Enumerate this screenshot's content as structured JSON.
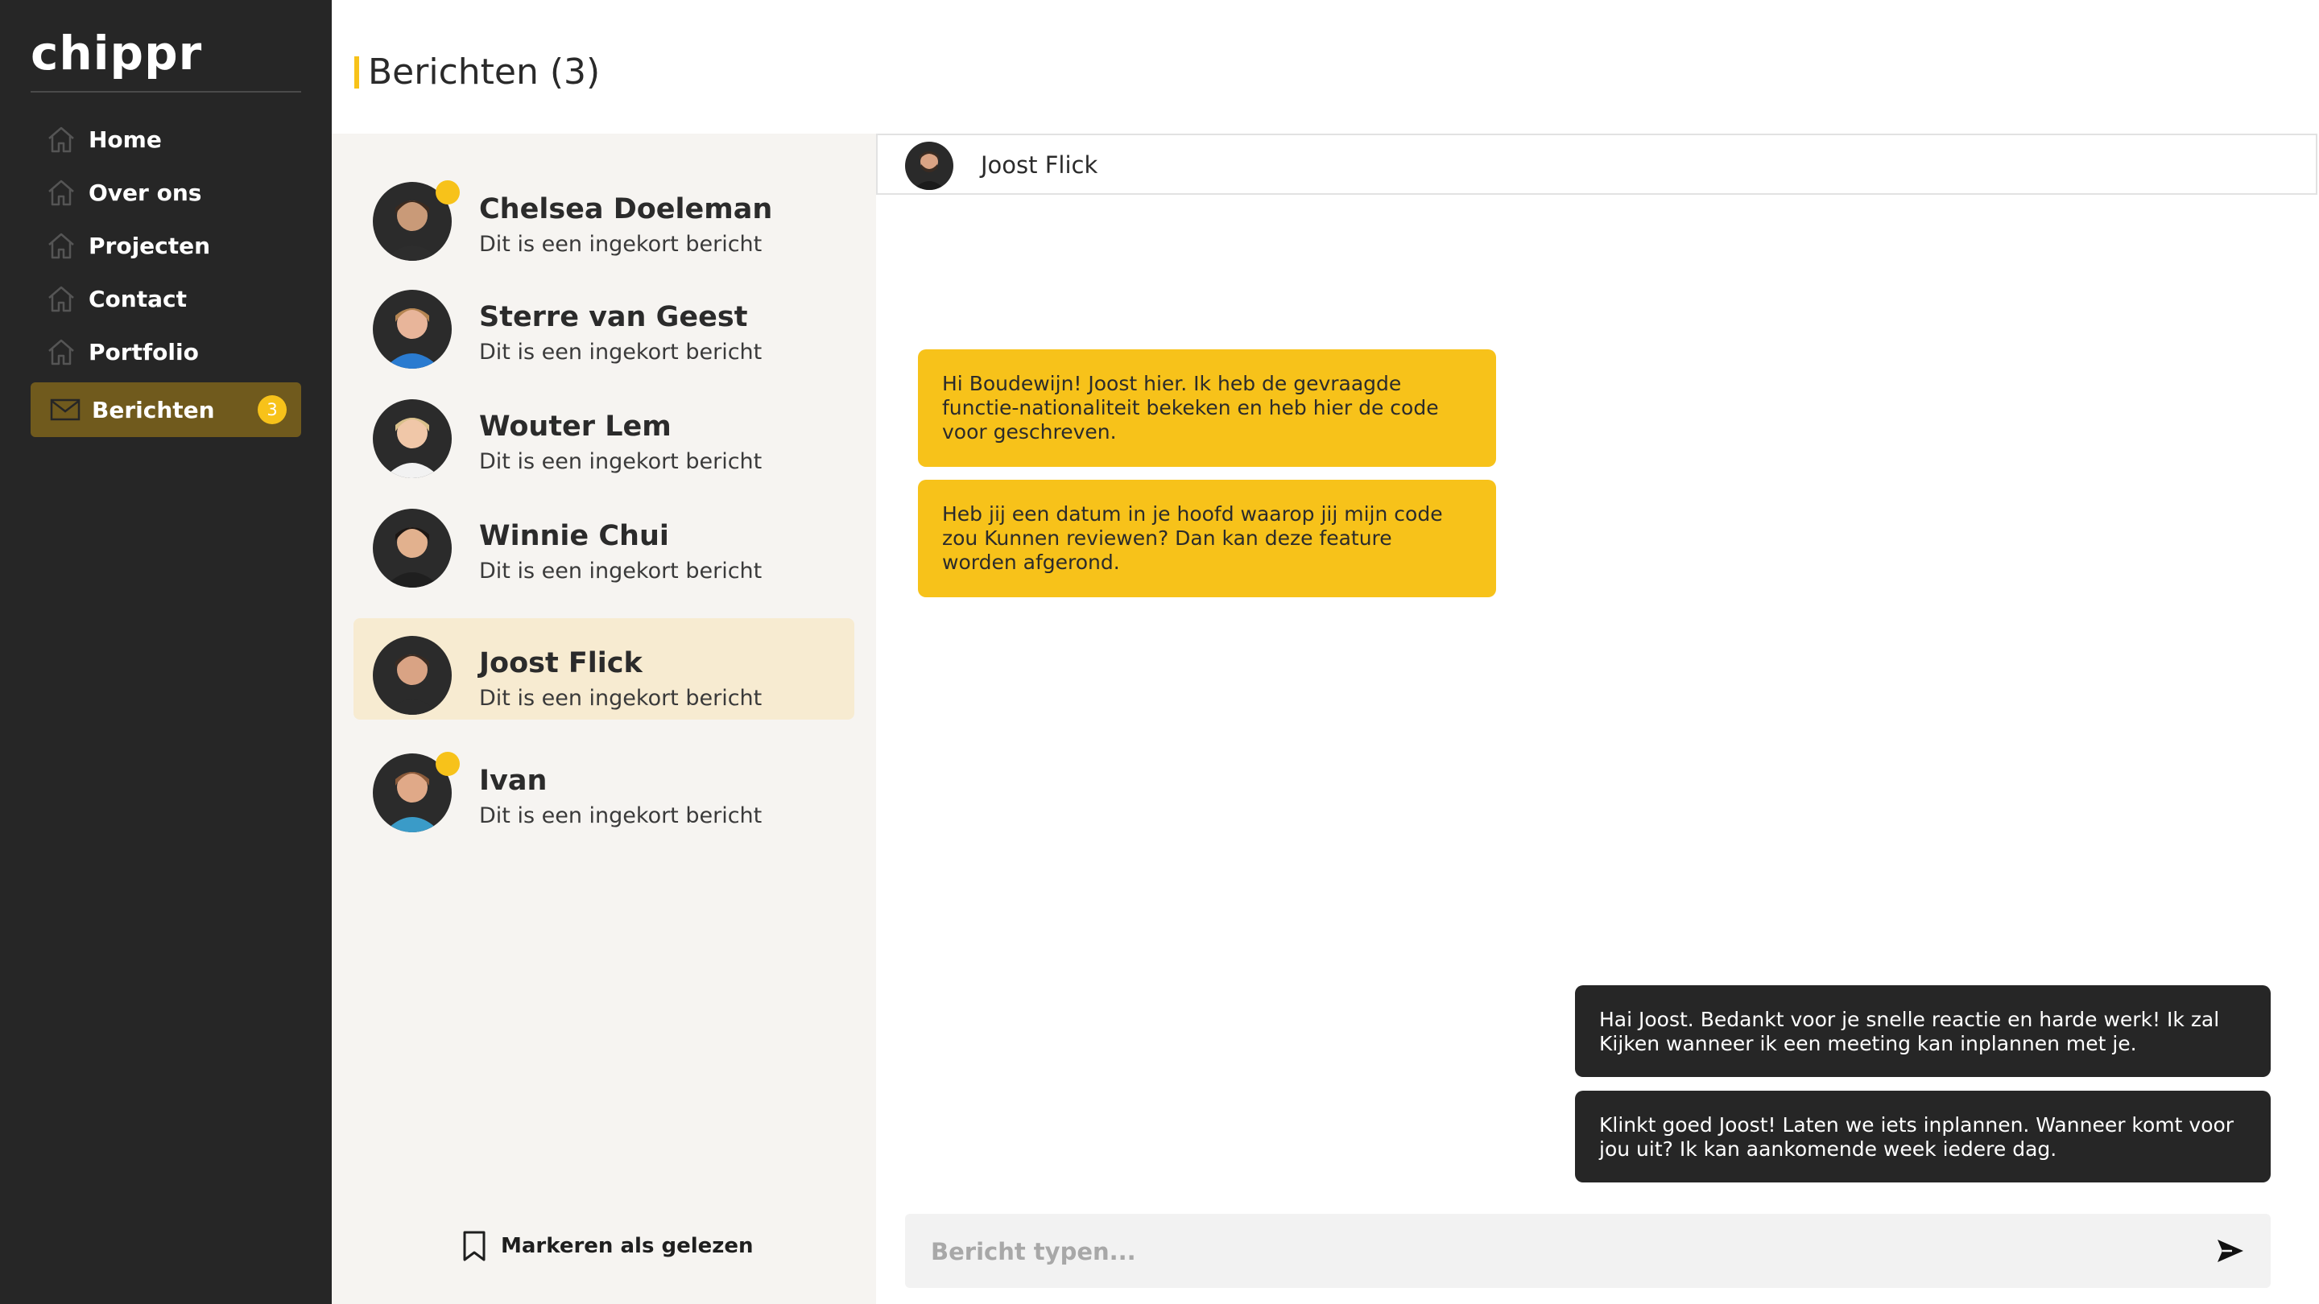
{
  "app": {
    "logo": "chippr"
  },
  "sidebar": {
    "items": [
      {
        "label": "Home"
      },
      {
        "label": "Over ons"
      },
      {
        "label": "Projecten"
      },
      {
        "label": "Contact"
      },
      {
        "label": "Portfolio"
      }
    ],
    "active": {
      "label": "Berichten",
      "badge": "3"
    }
  },
  "header": {
    "title": "Berichten (3)"
  },
  "contacts": [
    {
      "name": "Chelsea Doeleman",
      "preview": "Dit is een ingekort bericht",
      "unread": true,
      "skin": "#c99a78",
      "hair": "#3b2a1f",
      "shirt": "#2d2d2d"
    },
    {
      "name": "Sterre van Geest",
      "preview": "Dit is een ingekort bericht",
      "unread": false,
      "skin": "#e8b59a",
      "hair": "#b58552",
      "shirt": "#2a7bd0"
    },
    {
      "name": "Wouter Lem",
      "preview": "Dit is een ingekort bericht",
      "unread": false,
      "skin": "#f0c7a8",
      "hair": "#d9c08b",
      "shirt": "#f2f2f2"
    },
    {
      "name": "Winnie Chui",
      "preview": "Dit is een ingekort bericht",
      "unread": false,
      "skin": "#e2b18e",
      "hair": "#1d1714",
      "shirt": "#1f1f1f"
    },
    {
      "name": "Joost Flick",
      "preview": "Dit is een ingekort bericht",
      "unread": false,
      "active": true,
      "skin": "#d9a384",
      "hair": "#3a2b22",
      "shirt": "#2b2b2b"
    },
    {
      "name": "Ivan",
      "preview": "Dit is een ingekort bericht",
      "unread": true,
      "skin": "#e0a988",
      "hair": "#8a5a3a",
      "shirt": "#3a9bc8"
    }
  ],
  "mark_read": {
    "label": "Markeren als gelezen"
  },
  "chat": {
    "contact_name": "Joost Flick",
    "messages": [
      {
        "direction": "in",
        "text": "Hi Boudewijn! Joost hier. Ik heb de gevraagde functie-nationaliteit bekeken en heb hier de code voor geschreven."
      },
      {
        "direction": "in",
        "text": "Heb jij een datum in je hoofd waarop jij mijn code zou Kunnen reviewen? Dan kan deze feature worden afgerond."
      },
      {
        "direction": "out",
        "text": "Hai Joost. Bedankt voor je snelle reactie en harde werk! Ik zal Kijken wanneer ik een meeting kan inplannen met je."
      },
      {
        "direction": "out",
        "text": "Klinkt goed Joost! Laten we iets inplannen. Wanneer komt voor jou uit? Ik kan aankomende week iedere dag."
      }
    ],
    "composer": {
      "placeholder": "Bericht typen...",
      "value": ""
    }
  },
  "colors": {
    "accent": "#f7c21a",
    "sidebar": "#262626",
    "active_nav": "#705a1d",
    "list_bg": "#f6f4f1",
    "active_contact": "#f7ebd1"
  },
  "icons": {
    "nav": "home-icon",
    "messages": "envelope-icon",
    "mark_read": "bookmark-icon",
    "send": "send-icon"
  }
}
